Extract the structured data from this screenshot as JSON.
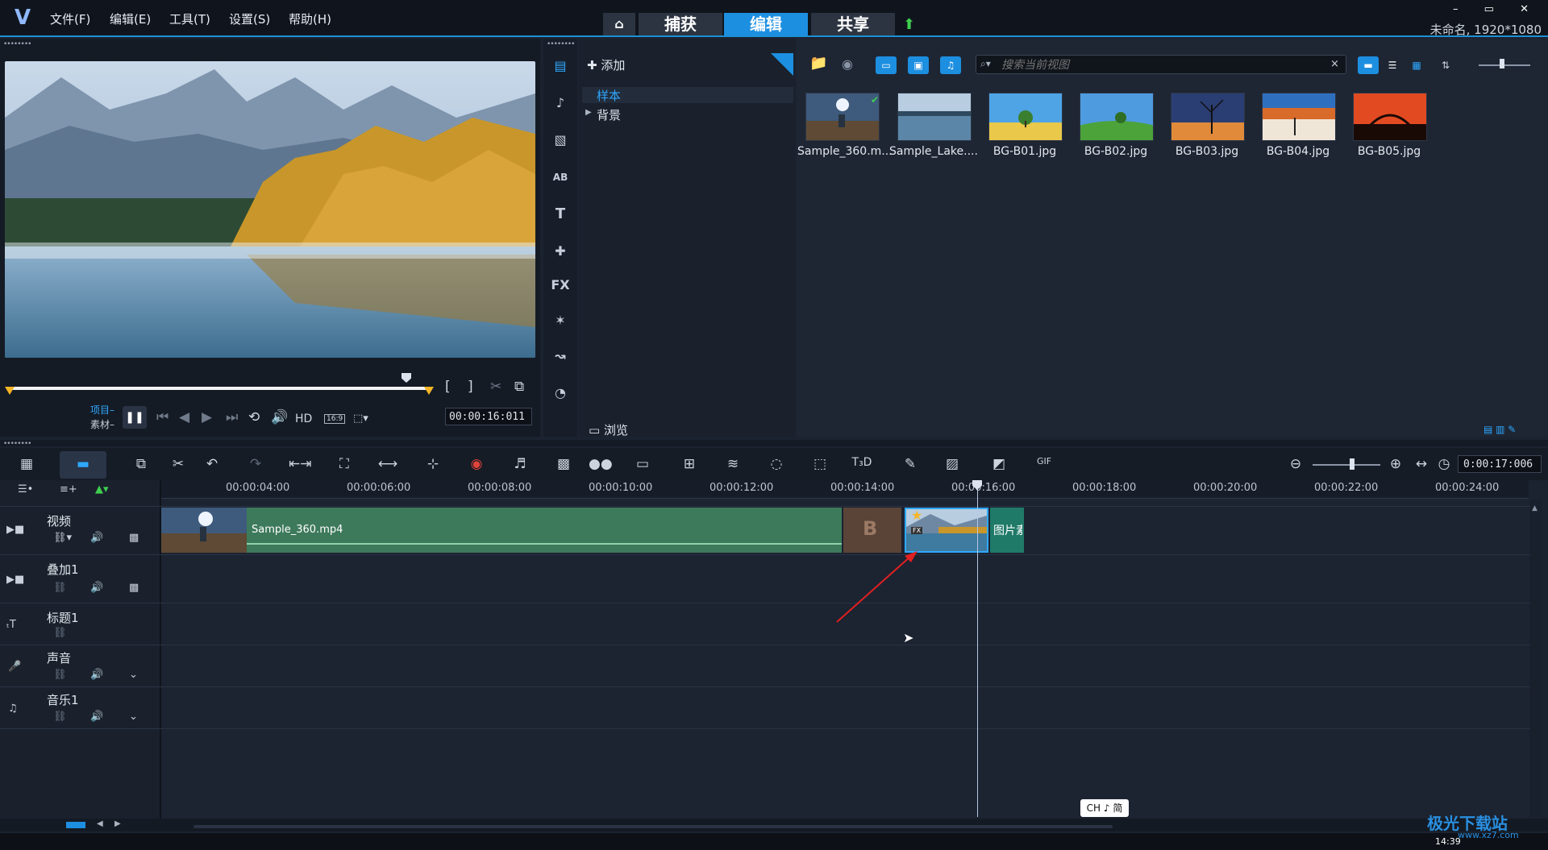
{
  "menu": {
    "logo": "V",
    "items": [
      "文件(F)",
      "编辑(E)",
      "工具(T)",
      "设置(S)",
      "帮助(H)"
    ]
  },
  "tabs": {
    "home_icon": "home-icon",
    "capture": "捕获",
    "edit": "编辑",
    "share": "共享",
    "upload_icon": "upload-icon"
  },
  "window": {
    "controls": "– ▭ ✕",
    "project_info": "未命名, 1920*1080"
  },
  "preview": {
    "mode_project": "项目–",
    "mode_clip": "素材–",
    "hd_label": "HD",
    "aspect_label": "16:9",
    "timecode": "00:00:16:011",
    "bracket_in": "[",
    "bracket_out": "]"
  },
  "library": {
    "add_label": "添加",
    "categories": [
      {
        "label": "样本",
        "selected": true
      },
      {
        "label": "背景",
        "selected": false
      }
    ],
    "browse_label": "浏览",
    "search_placeholder": "搜索当前视图",
    "search_clear": "×",
    "items": [
      {
        "label": "Sample_360.m...",
        "kind": "video",
        "checked": true
      },
      {
        "label": "Sample_Lake....",
        "kind": "video",
        "checked": false
      },
      {
        "label": "BG-B01.jpg",
        "kind": "image",
        "checked": false
      },
      {
        "label": "BG-B02.jpg",
        "kind": "image",
        "checked": false
      },
      {
        "label": "BG-B03.jpg",
        "kind": "image",
        "checked": false
      },
      {
        "label": "BG-B04.jpg",
        "kind": "image",
        "checked": false
      },
      {
        "label": "BG-B05.jpg",
        "kind": "image",
        "checked": false
      }
    ],
    "side_icons": [
      "media-icon",
      "audio-icon",
      "transition-icon",
      "title-ab-icon",
      "text-icon",
      "graphics-icon",
      "fx-icon",
      "magic-icon",
      "path-icon",
      "speed-icon"
    ],
    "side_fx_label": "FX",
    "side_text_label": "T",
    "side_ab_label": "AB"
  },
  "timeline": {
    "timecode": "0:00:17:006",
    "ruler_ticks": [
      "00:00:04:00",
      "00:00:06:00",
      "00:00:08:00",
      "00:00:10:00",
      "00:00:12:00",
      "00:00:14:00",
      "00:00:16:00",
      "00:00:18:00",
      "00:00:20:00",
      "00:00:22:00",
      "00:00:24:00"
    ],
    "tracks": [
      {
        "name": "视频",
        "icon": "video-track-icon"
      },
      {
        "name": "叠加1",
        "icon": "overlay-track-icon"
      },
      {
        "name": "标题1",
        "icon": "title-track-icon"
      },
      {
        "name": "声音",
        "icon": "voice-track-icon"
      },
      {
        "name": "音乐1",
        "icon": "music-track-icon"
      }
    ],
    "clips": {
      "main_video": "Sample_360.mp4",
      "transition_label": "B",
      "image_clip": "图片素",
      "fx_badge": "FX"
    }
  },
  "system": {
    "ime": "CH ♪ 简",
    "clock": "14:39",
    "watermark": "极光下载站",
    "watermark_sub": "www.xz7.com"
  }
}
